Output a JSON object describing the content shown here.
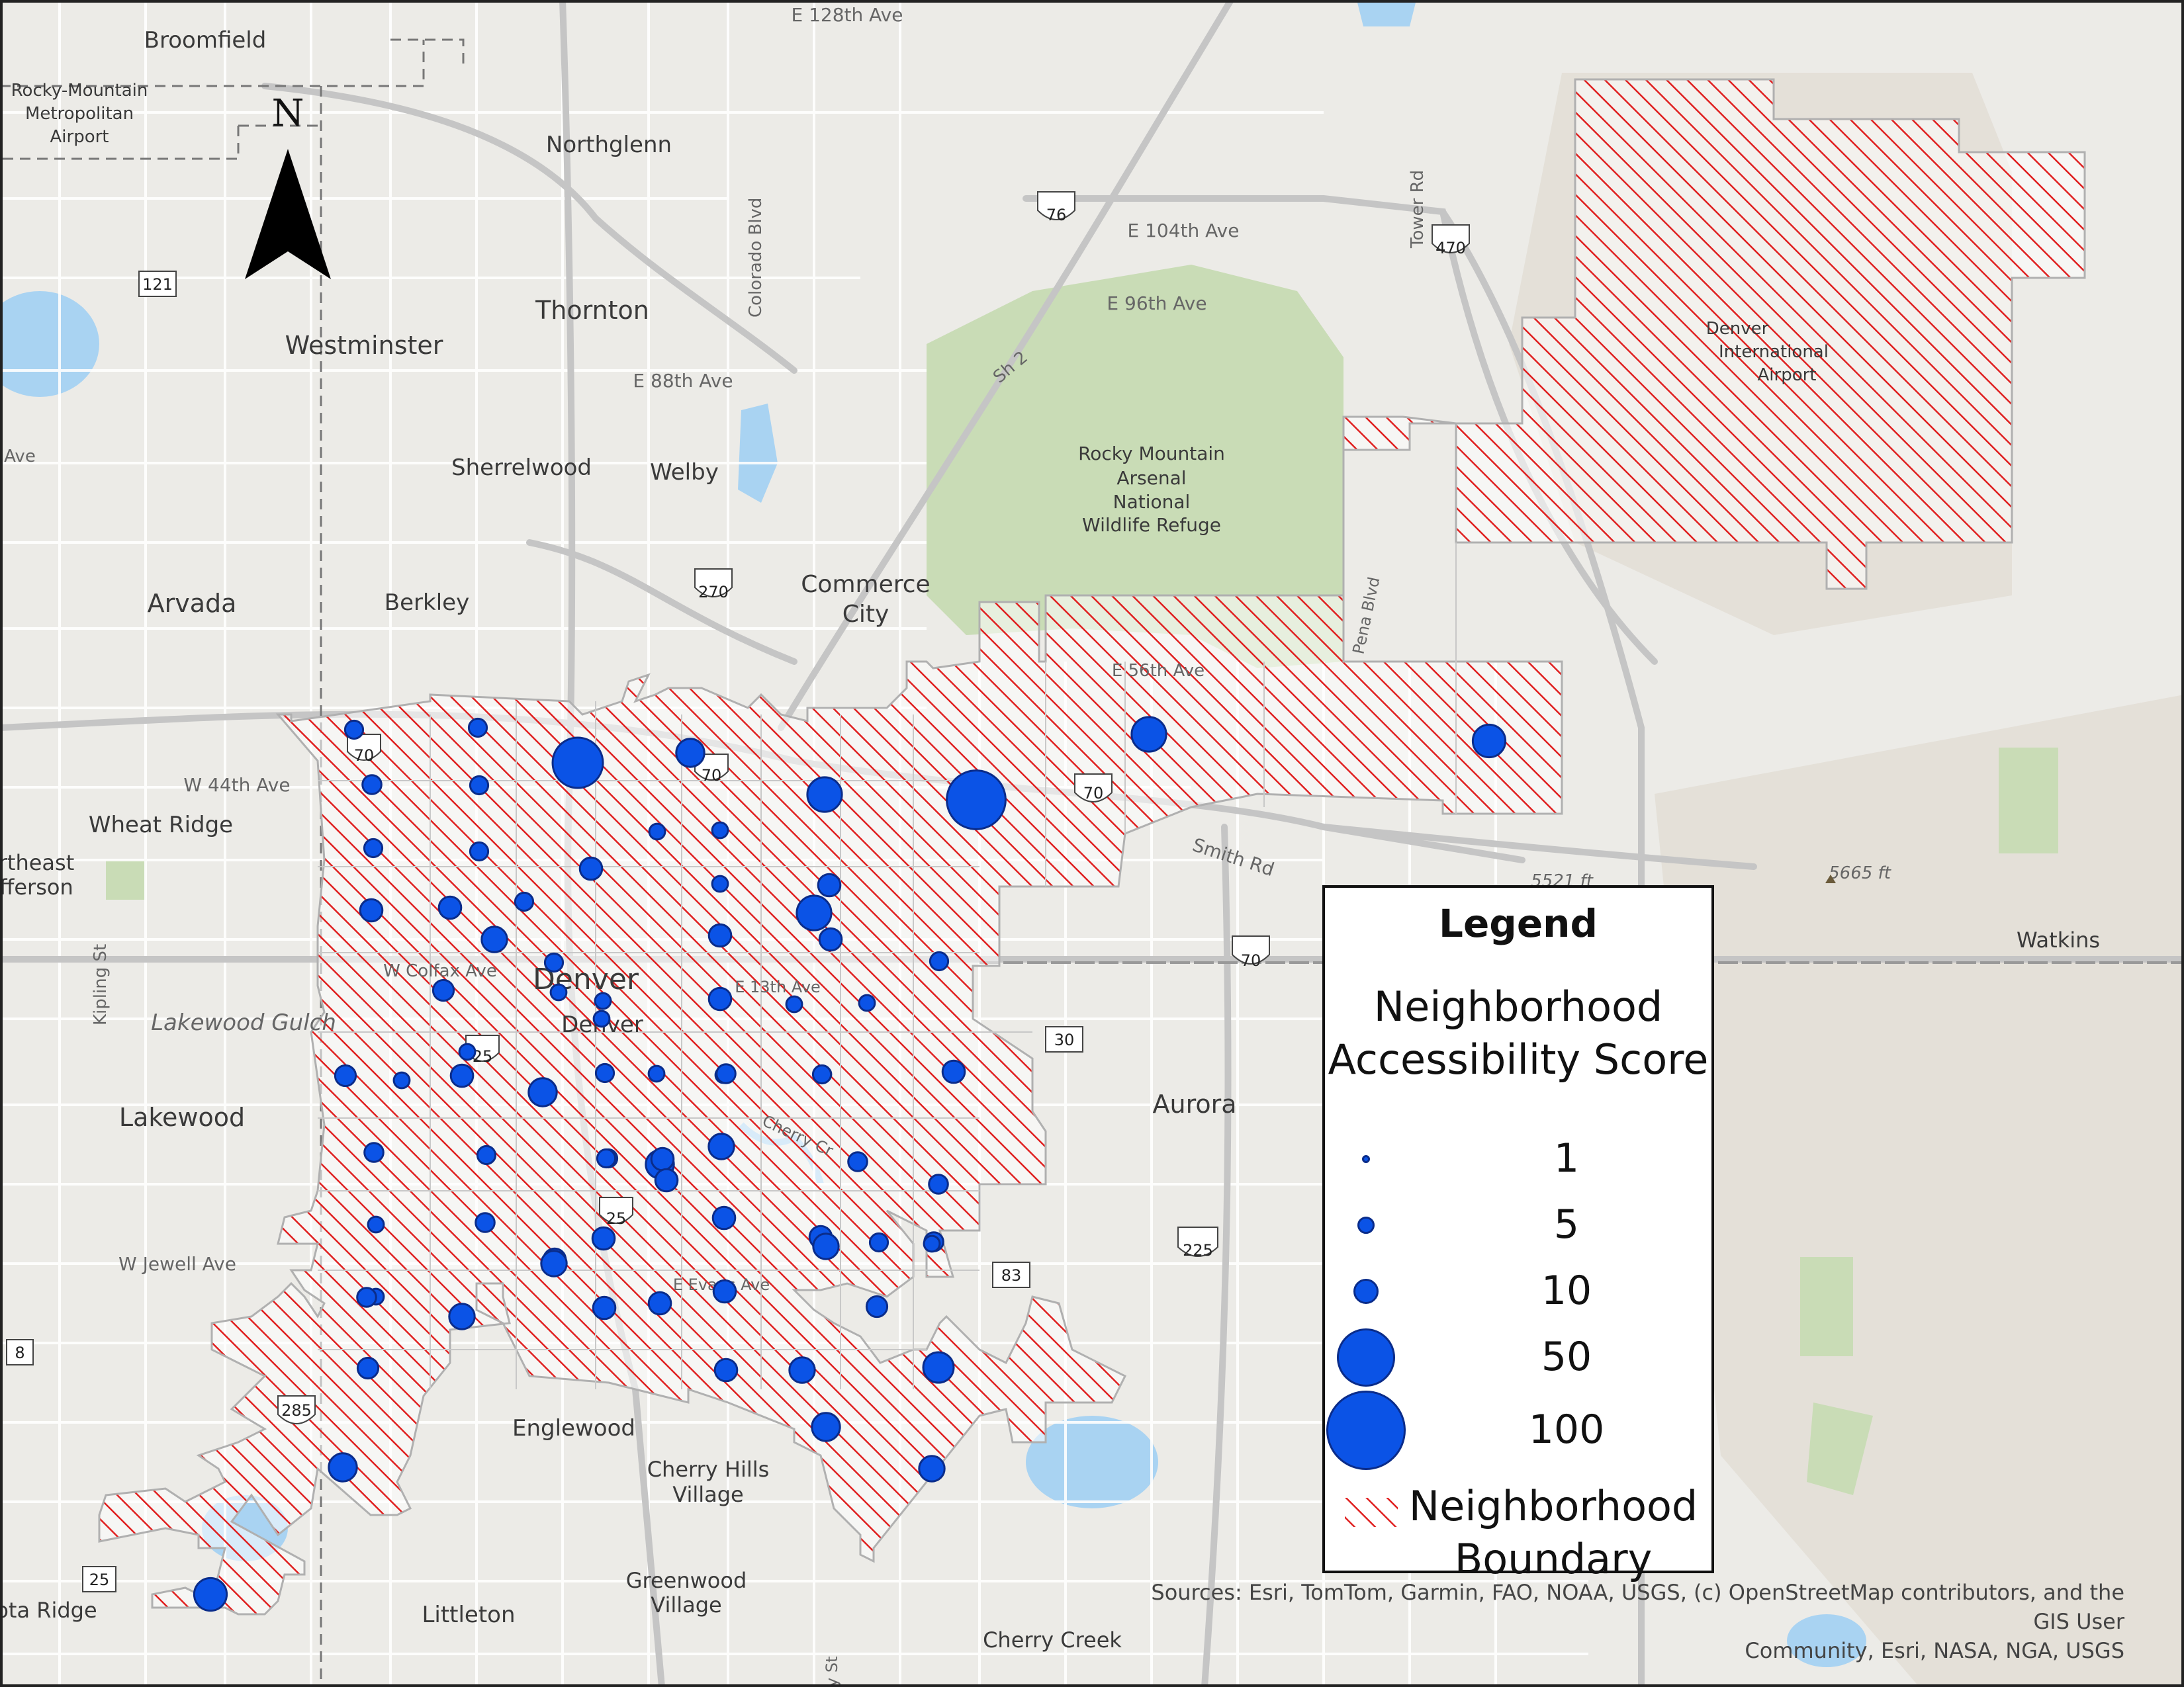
{
  "places": [
    {
      "name": "Broomfield"
    },
    {
      "name": "Rocky-Mountain"
    },
    {
      "name": "Metropolitan"
    },
    {
      "name": "Airport"
    },
    {
      "name": "Northglenn"
    },
    {
      "name": "Thornton"
    },
    {
      "name": "Westminster"
    },
    {
      "name": "Sherrelwood"
    },
    {
      "name": "Welby"
    },
    {
      "name": "Arvada"
    },
    {
      "name": "Berkley"
    },
    {
      "name": "Commerce"
    },
    {
      "name": "City"
    },
    {
      "name": "Wheat Ridge"
    },
    {
      "name": "rtheast"
    },
    {
      "name": "fferson"
    },
    {
      "name": "Denver"
    },
    {
      "name": "Lakewood"
    },
    {
      "name": "Aurora"
    },
    {
      "name": "Englewood"
    },
    {
      "name": "Cherry Hills"
    },
    {
      "name": "Village"
    },
    {
      "name": "Greenwood"
    },
    {
      "name": "Village"
    },
    {
      "name": "Littleton"
    },
    {
      "name": "Cherry Creek"
    },
    {
      "name": "Watkins"
    },
    {
      "name": "ota Ridge"
    },
    {
      "name": "Rocky Mountain"
    },
    {
      "name": "Arsenal"
    },
    {
      "name": "National"
    },
    {
      "name": "Wildlife Refuge"
    },
    {
      "name": "Denver"
    },
    {
      "name": "International"
    },
    {
      "name": "Airport"
    },
    {
      "name": "Denver"
    }
  ],
  "roads": [
    {
      "name": "E 128th Ave"
    },
    {
      "name": "E 104th Ave"
    },
    {
      "name": "E 96th Ave"
    },
    {
      "name": "E 88th Ave"
    },
    {
      "name": "Colorado Blvd"
    },
    {
      "name": "Sh 2"
    },
    {
      "name": "Tower Rd"
    },
    {
      "name": "W 44th Ave"
    },
    {
      "name": "E 56th Ave"
    },
    {
      "name": "Smith Rd"
    },
    {
      "name": "Pena Blvd"
    },
    {
      "name": "Kipling St"
    },
    {
      "name": "Lakewood Gulch"
    },
    {
      "name": "W Colfax Ave"
    },
    {
      "name": "E 13th Ave"
    },
    {
      "name": "W Jewell Ave"
    },
    {
      "name": "E Evans Ave"
    },
    {
      "name": "Cherry Cr"
    },
    {
      "name": "y St"
    },
    {
      "name": "Ave"
    }
  ],
  "shields": [
    "121",
    "76",
    "470",
    "270",
    "70",
    "70",
    "70",
    "25",
    "25",
    "285",
    "30",
    "225",
    "83",
    "8",
    "25"
  ],
  "elevations": [
    {
      "label": "5521 ft"
    },
    {
      "label": "5665 ft"
    }
  ],
  "north_label": "N",
  "legend": {
    "title": "Legend",
    "score_title_line1": "Neighborhood",
    "score_title_line2": "Accessibility Score",
    "sizes": [
      {
        "label": "1",
        "value": 1
      },
      {
        "label": "5",
        "value": 5
      },
      {
        "label": "10",
        "value": 10
      },
      {
        "label": "50",
        "value": 50
      },
      {
        "label": "100",
        "value": 100
      }
    ],
    "boundary_line1": "Neighborhood",
    "boundary_line2": "Boundary"
  },
  "sources_line1": "Sources:  Esri, TomTom, Garmin, FAO, NOAA, USGS, (c) OpenStreetMap contributors, and the GIS User",
  "sources_line2": "Community, Esri, NASA, NGA, USGS",
  "colors": {
    "circle": "#0b53e6",
    "hatch": "#e02020",
    "park": "#c9dcb6",
    "water": "#a9d3f2",
    "background": "#ecebe7"
  },
  "neighborhood_scores": [
    {
      "value": 5
    },
    {
      "value": 5
    },
    {
      "value": 50
    },
    {
      "value": 20
    },
    {
      "value": 35
    },
    {
      "value": 80
    },
    {
      "value": 6
    },
    {
      "value": 5
    },
    {
      "value": 35
    },
    {
      "value": 5
    },
    {
      "value": 5
    },
    {
      "value": 10
    },
    {
      "value": 3
    },
    {
      "value": 3
    },
    {
      "value": 10
    },
    {
      "value": 10
    },
    {
      "value": 5
    },
    {
      "value": 3
    },
    {
      "value": 10
    },
    {
      "value": 10
    },
    {
      "value": 10
    },
    {
      "value": 8
    },
    {
      "value": 5
    },
    {
      "value": 15
    },
    {
      "value": 3
    },
    {
      "value": 10
    },
    {
      "value": 5
    },
    {
      "value": 8
    },
    {
      "value": 3
    },
    {
      "value": 10
    },
    {
      "value": 15
    },
    {
      "value": 3
    },
    {
      "value": 3
    },
    {
      "value": 3
    },
    {
      "value": 3
    },
    {
      "value": 3
    },
    {
      "value": 3
    },
    {
      "value": 6
    },
    {
      "value": 3
    },
    {
      "value": 5
    },
    {
      "value": 20
    },
    {
      "value": 5
    },
    {
      "value": 5
    },
    {
      "value": 6
    },
    {
      "value": 3
    },
    {
      "value": 10
    },
    {
      "value": 3
    },
    {
      "value": 6
    },
    {
      "value": 5
    },
    {
      "value": 20
    },
    {
      "value": 15
    },
    {
      "value": 5
    },
    {
      "value": 6
    },
    {
      "value": 3
    },
    {
      "value": 10
    },
    {
      "value": 10
    },
    {
      "value": 10
    },
    {
      "value": 10
    },
    {
      "value": 6
    },
    {
      "value": 6
    },
    {
      "value": 15
    },
    {
      "value": 6
    },
    {
      "value": 10
    },
    {
      "value": 15
    },
    {
      "value": 10
    },
    {
      "value": 3
    },
    {
      "value": 8
    },
    {
      "value": 10
    },
    {
      "value": 8
    },
    {
      "value": 10
    },
    {
      "value": 10
    },
    {
      "value": 15
    },
    {
      "value": 5
    },
    {
      "value": 25
    },
    {
      "value": 10
    },
    {
      "value": 15
    },
    {
      "value": 15
    },
    {
      "value": 20
    },
    {
      "value": 20
    },
    {
      "value": 30
    },
    {
      "value": 35
    },
    {
      "value": 30
    }
  ]
}
